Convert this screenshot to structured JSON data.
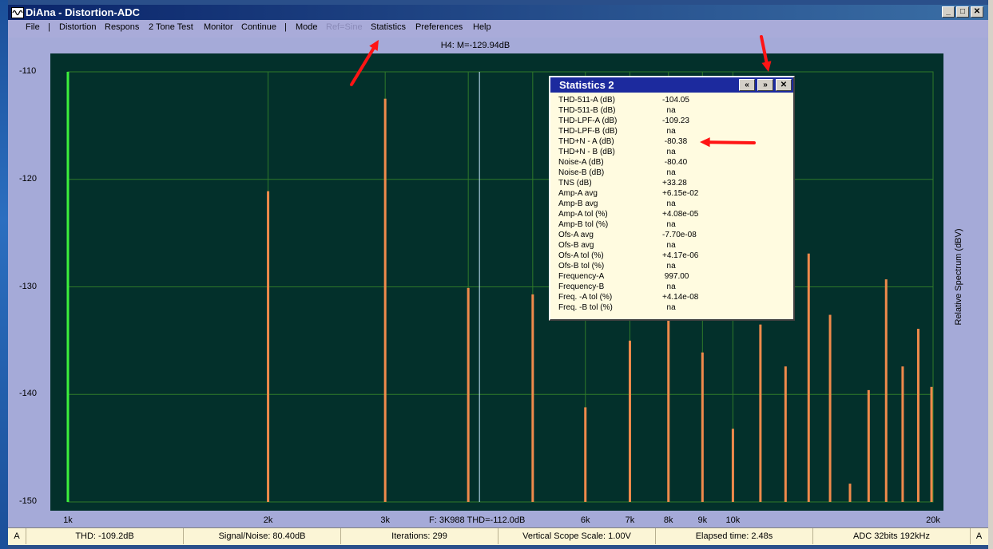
{
  "window": {
    "title": "DiAna - Distortion-ADC",
    "minimize": "_",
    "maximize": "□",
    "close": "✕"
  },
  "menu": [
    {
      "label": "File",
      "enabled": true
    },
    {
      "label": "|",
      "sep": true
    },
    {
      "label": "Distortion",
      "enabled": true
    },
    {
      "label": "Respons",
      "enabled": true
    },
    {
      "label": "2 Tone Test",
      "enabled": true
    },
    {
      "label": "Monitor",
      "enabled": true
    },
    {
      "label": "Continue",
      "enabled": true
    },
    {
      "label": "|",
      "sep": true
    },
    {
      "label": "Mode",
      "enabled": true
    },
    {
      "label": "Ref=Sine",
      "enabled": false
    },
    {
      "label": "Statistics",
      "enabled": true
    },
    {
      "label": "Preferences",
      "enabled": true
    },
    {
      "label": "Help",
      "enabled": true
    }
  ],
  "plot": {
    "marker_readout": "H4: M=-129.94dB",
    "cursor_readout": "F: 3K988 THD=-112.0dB",
    "y_axis_label": "Relative Spectrum  (dBV)",
    "colors": {
      "background": "#03302b",
      "grid": "#2f7a2a",
      "bars": "#f08a4b",
      "fundamental": "#3cf03c",
      "cursor": "#c8e8ff"
    }
  },
  "chart_data": {
    "type": "bar",
    "x_scale": "log",
    "xlim": [
      1000,
      20000
    ],
    "ylim": [
      -150,
      -110
    ],
    "y_ticks": [
      -110,
      -120,
      -130,
      -140,
      -150
    ],
    "x_tick_labels": [
      {
        "label": "1k",
        "value": 1000
      },
      {
        "label": "2k",
        "value": 2000
      },
      {
        "label": "3k",
        "value": 3000
      },
      {
        "label": "6k",
        "value": 6000
      },
      {
        "label": "7k",
        "value": 7000
      },
      {
        "label": "8k",
        "value": 8000
      },
      {
        "label": "9k",
        "value": 9000
      },
      {
        "label": "10k",
        "value": 10000
      },
      {
        "label": "20k",
        "value": 20000
      }
    ],
    "cursor_x": 4000,
    "fundamental": {
      "x": 1000,
      "y": -110
    },
    "bars": [
      {
        "x": 2000,
        "y": -121.1
      },
      {
        "x": 3000,
        "y": -112.5
      },
      {
        "x": 4000,
        "y": -130.1
      },
      {
        "x": 5000,
        "y": -130.7
      },
      {
        "x": 6000,
        "y": -141.2
      },
      {
        "x": 7000,
        "y": -135.0
      },
      {
        "x": 8000,
        "y": -131.5
      },
      {
        "x": 9000,
        "y": -136.1
      },
      {
        "x": 10000,
        "y": -143.2
      },
      {
        "x": 11000,
        "y": -133.5
      },
      {
        "x": 12000,
        "y": -137.4
      },
      {
        "x": 13000,
        "y": -126.9
      },
      {
        "x": 14000,
        "y": -132.6
      },
      {
        "x": 15000,
        "y": -148.3
      },
      {
        "x": 16000,
        "y": -139.6
      },
      {
        "x": 17000,
        "y": -129.3
      },
      {
        "x": 18000,
        "y": -137.4
      },
      {
        "x": 19000,
        "y": -133.9
      },
      {
        "x": 20000,
        "y": -139.3
      }
    ]
  },
  "statistics": {
    "title": "Statistics 2",
    "prev": "«",
    "next": "»",
    "close": "✕",
    "rows": [
      {
        "k": "THD-511-A (dB)",
        "v": "-104.05"
      },
      {
        "k": "THD-511-B (dB)",
        "v": "  na"
      },
      {
        "k": "THD-LPF-A (dB)",
        "v": "-109.23"
      },
      {
        "k": "THD-LPF-B (dB)",
        "v": "  na"
      },
      {
        "k": "THD+N - A (dB)",
        "v": " -80.38"
      },
      {
        "k": "THD+N - B (dB)",
        "v": "  na"
      },
      {
        "k": "Noise-A (dB)",
        "v": " -80.40"
      },
      {
        "k": "Noise-B (dB)",
        "v": "  na"
      },
      {
        "k": "TNS (dB)",
        "v": "+33.28"
      },
      {
        "k": "Amp-A avg",
        "v": "+6.15e-02"
      },
      {
        "k": "Amp-B avg",
        "v": "  na"
      },
      {
        "k": "Amp-A tol (%)",
        "v": "+4.08e-05"
      },
      {
        "k": "Amp-B tol (%)",
        "v": "  na"
      },
      {
        "k": "Ofs-A avg",
        "v": "-7.70e-08"
      },
      {
        "k": "Ofs-B avg",
        "v": "  na"
      },
      {
        "k": "Ofs-A tol (%)",
        "v": "+4.17e-06"
      },
      {
        "k": "Ofs-B tol (%)",
        "v": "  na"
      },
      {
        "k": "Frequency-A",
        "v": " 997.00"
      },
      {
        "k": "Frequency-B",
        "v": "  na"
      },
      {
        "k": "Freq. -A  tol (%)",
        "v": "+4.14e-08"
      },
      {
        "k": "Freq. -B  tol (%)",
        "v": "  na"
      }
    ]
  },
  "status": {
    "left_mark": "A",
    "thd": "THD: -109.2dB",
    "snr": "Signal/Noise:  80.40dB",
    "iterations": "Iterations: 299",
    "scope": "Vertical Scope Scale: 1.00V",
    "elapsed": "Elapsed time: 2.48s",
    "adc": "ADC 32bits 192kHz",
    "right_mark": "A"
  },
  "annotations": {
    "arrow_color": "#ff1414"
  }
}
